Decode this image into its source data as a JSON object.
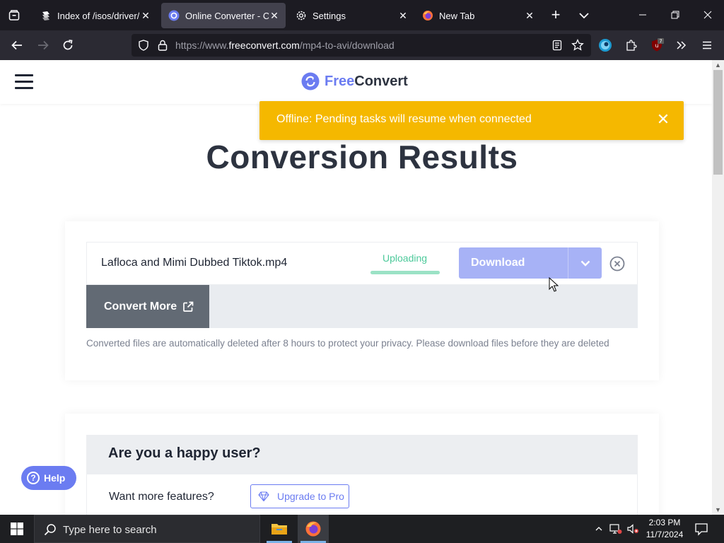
{
  "browser": {
    "tabs": [
      {
        "title": "Index of /isos/driver/",
        "active": false,
        "icon": "folder-stack-icon"
      },
      {
        "title": "Online Converter - Con",
        "active": true,
        "icon": "freeconvert-icon"
      },
      {
        "title": "Settings",
        "active": false,
        "icon": "gear-icon"
      },
      {
        "title": "New Tab",
        "active": false,
        "icon": "firefox-icon"
      }
    ],
    "url": {
      "prefix": "https://www.",
      "domain": "freeconvert.com",
      "path": "/mp4-to-avi/download"
    },
    "extension_badge": "7"
  },
  "site": {
    "logo": {
      "part1": "Free",
      "part2": "Convert"
    },
    "toast": {
      "text": "Offline: Pending tasks will resume when connected"
    },
    "title": "Conversion Results",
    "file": {
      "name": "Lafloca and Mimi Dubbed Tiktok.mp4",
      "status": "Uploading",
      "progress": 1.0,
      "download_label": "Download"
    },
    "convert_more_label": "Convert More",
    "privacy_note": "Converted files are automatically deleted after 8 hours to protect your privacy. Please download files before they are deleted",
    "happy": {
      "heading": "Are you a happy user?",
      "features_label": "Want more features?",
      "upgrade_label": "Upgrade to Pro"
    },
    "help_label": "Help"
  },
  "taskbar": {
    "search_placeholder": "Type here to search",
    "time": "2:03 PM",
    "date": "11/7/2024"
  },
  "colors": {
    "accent": "#6b7cf1",
    "toast": "#f5b800",
    "status_green": "#4cc99a"
  }
}
